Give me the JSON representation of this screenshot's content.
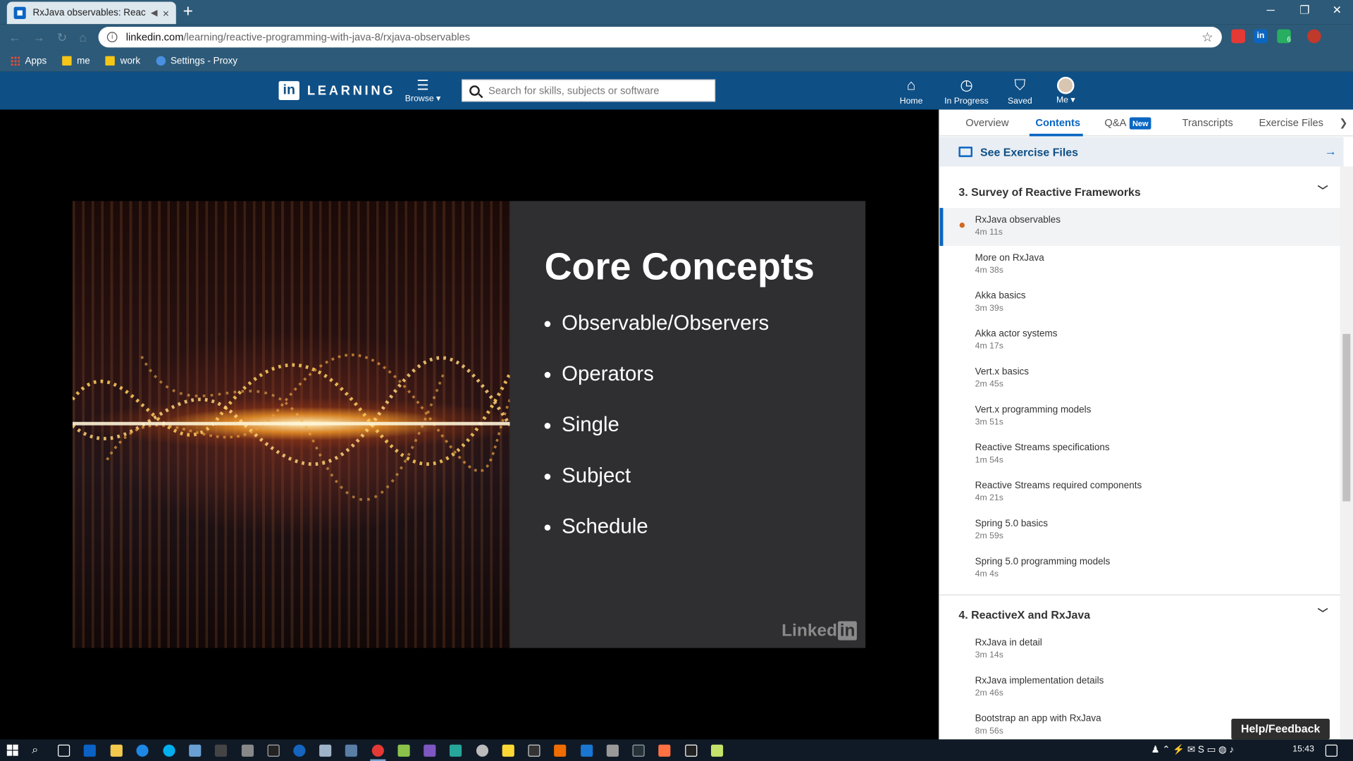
{
  "browser": {
    "tab_title": "RxJava observables: Reactive",
    "new_tab": "+",
    "tab_close": "×",
    "win_minimize": "─",
    "win_restore": "❐",
    "win_close": "✕",
    "url_domain": "linkedin.com",
    "url_path": "/learning/reactive-programming-with-java-8/rxjava-observables",
    "bookmarks": [
      {
        "label": "Apps",
        "icon": "apps-grid-icon"
      },
      {
        "label": "me",
        "icon": "folder-icon"
      },
      {
        "label": "work",
        "icon": "folder-icon"
      },
      {
        "label": "Settings - Proxy",
        "icon": "gear-icon"
      }
    ],
    "extension_badge": "6"
  },
  "header": {
    "logo_in": "in",
    "logo_text": "LEARNING",
    "browse_label": "Browse ▾",
    "search_placeholder": "Search for skills, subjects or software",
    "nav": [
      {
        "label": "Home",
        "icon": "home-icon"
      },
      {
        "label": "In Progress",
        "icon": "clock-icon"
      },
      {
        "label": "Saved",
        "icon": "bookmark-icon"
      },
      {
        "label": "Me ▾",
        "icon": "avatar"
      }
    ]
  },
  "slide": {
    "title": "Core Concepts",
    "bullets": [
      "Observable/Observers",
      "Operators",
      "Single",
      "Subject",
      "Schedule"
    ],
    "watermark": "Linked",
    "watermark_in": "in"
  },
  "sidebar": {
    "tabs": [
      {
        "label": "Overview"
      },
      {
        "label": "Contents",
        "active": true
      },
      {
        "label": "Q&A",
        "badge": "New"
      },
      {
        "label": "Transcripts"
      },
      {
        "label": "Exercise Files"
      }
    ],
    "exercise_files_label": "See Exercise Files",
    "sections": [
      {
        "title": "3. Survey of Reactive Frameworks",
        "items": [
          {
            "name": "RxJava observables",
            "duration": "4m 11s",
            "current": true
          },
          {
            "name": "More on RxJava",
            "duration": "4m 38s"
          },
          {
            "name": "Akka basics",
            "duration": "3m 39s"
          },
          {
            "name": "Akka actor systems",
            "duration": "4m 17s"
          },
          {
            "name": "Vert.x basics",
            "duration": "2m 45s"
          },
          {
            "name": "Vert.x programming models",
            "duration": "3m 51s"
          },
          {
            "name": "Reactive Streams specifications",
            "duration": "1m 54s"
          },
          {
            "name": "Reactive Streams required components",
            "duration": "4m 21s"
          },
          {
            "name": "Spring 5.0 basics",
            "duration": "2m 59s"
          },
          {
            "name": "Spring 5.0 programming models",
            "duration": "4m 4s"
          }
        ]
      },
      {
        "title": "4. ReactiveX and RxJava",
        "items": [
          {
            "name": "RxJava in detail",
            "duration": "3m 14s"
          },
          {
            "name": "RxJava implementation details",
            "duration": "2m 46s"
          },
          {
            "name": "Bootstrap an app with RxJava",
            "duration": "8m 56s"
          }
        ]
      }
    ]
  },
  "help_label": "Help/Feedback",
  "taskbar": {
    "clock": "15:43"
  }
}
